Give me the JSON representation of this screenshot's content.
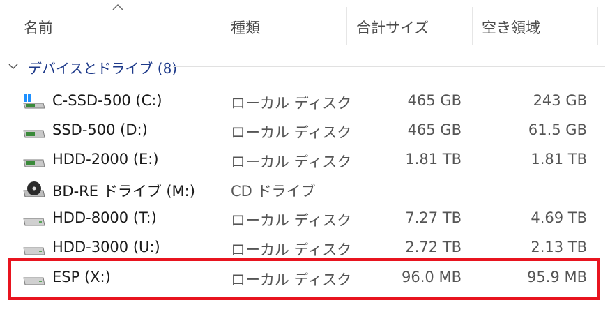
{
  "header": {
    "columns": [
      {
        "label": "名前"
      },
      {
        "label": "種類"
      },
      {
        "label": "合計サイズ"
      },
      {
        "label": "空き領域"
      }
    ]
  },
  "group": {
    "label": "デバイスとドライブ",
    "count": "(8)"
  },
  "drives": [
    {
      "name": "C-SSD-500 (C:)",
      "type": "ローカル ディスク",
      "total": "465 GB",
      "free": "243 GB",
      "icon": "windows-drive-icon"
    },
    {
      "name": "SSD-500 (D:)",
      "type": "ローカル ディスク",
      "total": "465 GB",
      "free": "61.5 GB",
      "icon": "drive-icon"
    },
    {
      "name": "HDD-2000 (E:)",
      "type": "ローカル ディスク",
      "total": "1.81 TB",
      "free": "1.81 TB",
      "icon": "drive-icon"
    },
    {
      "name": "BD-RE ドライブ (M:)",
      "type": "CD ドライブ",
      "total": "",
      "free": "",
      "icon": "bd-drive-icon"
    },
    {
      "name": "HDD-8000 (T:)",
      "type": "ローカル ディスク",
      "total": "7.27 TB",
      "free": "4.69 TB",
      "icon": "hdd-icon"
    },
    {
      "name": "HDD-3000 (U:)",
      "type": "ローカル ディスク",
      "total": "2.72 TB",
      "free": "2.13 TB",
      "icon": "hdd-icon"
    },
    {
      "name": "ESP (X:)",
      "type": "ローカル ディスク",
      "total": "96.0 MB",
      "free": "95.9 MB",
      "icon": "hdd-icon"
    }
  ],
  "colors": {
    "highlight": "#e8141f",
    "group_text": "#1e3a8a"
  }
}
